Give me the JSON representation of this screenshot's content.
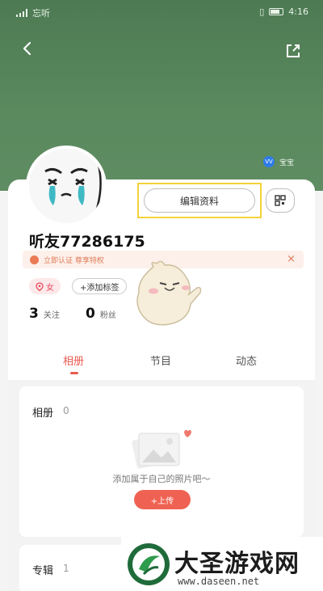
{
  "status_bar": {
    "left_text": "忘听",
    "time": "4:16"
  },
  "header": {
    "vip_label": "宝宝",
    "vip_icon_text": "VV"
  },
  "profile": {
    "edit_button_label": "编辑资料",
    "username": "听友77286175",
    "verify_text": "立即认证  尊享特权",
    "verify_close": "×",
    "gender_label": "女",
    "add_tag_label": "+添加标签",
    "follow_count": "3",
    "follow_label": "关注",
    "fans_count": "0",
    "fans_label": "粉丝"
  },
  "tabs": [
    {
      "label": "相册",
      "active": true
    },
    {
      "label": "节目",
      "active": false
    },
    {
      "label": "动态",
      "active": false
    }
  ],
  "album": {
    "title": "相册",
    "count": "0",
    "empty_text": "添加属于自己的照片吧～",
    "upload_label": "+上传"
  },
  "album2": {
    "title": "专辑",
    "count": "1"
  },
  "watermark": {
    "title": "大圣游戏网",
    "url": "www.daseen.net"
  },
  "colors": {
    "header_green": "#5b8a5f",
    "accent_red": "#e85a4f",
    "highlight_yellow": "#f3d23a"
  }
}
